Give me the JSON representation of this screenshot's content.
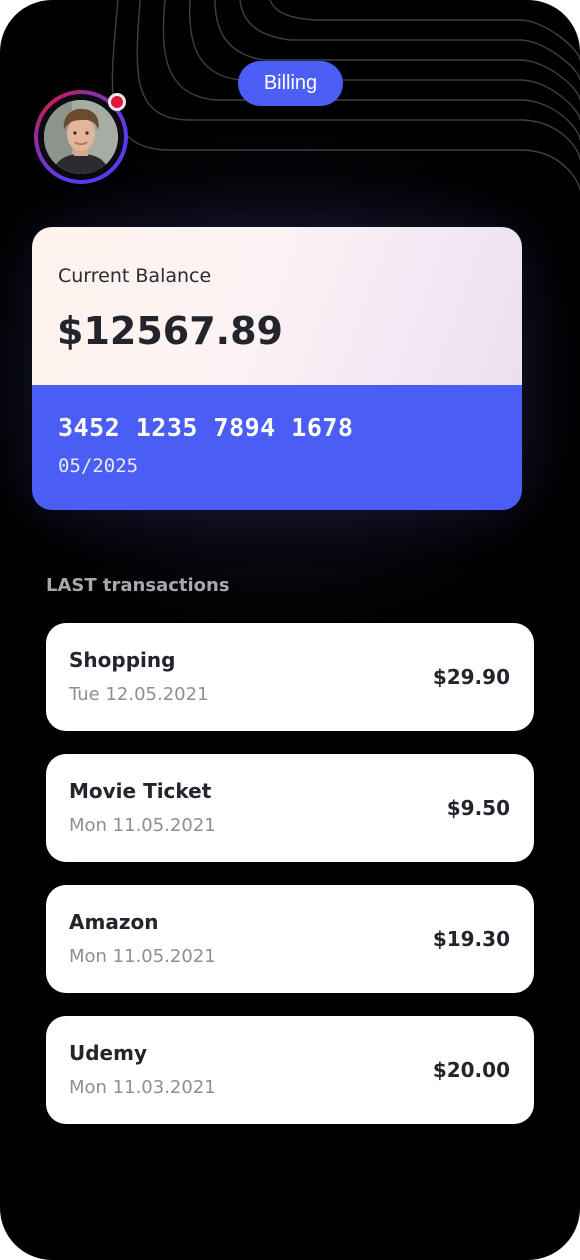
{
  "header": {
    "tab_label": "Billing",
    "colors": {
      "tab": "#4b5ef5",
      "notification": "#e3153c"
    }
  },
  "card": {
    "balance_label": "Current Balance",
    "balance_value": "$12567.89",
    "card_number": "3452 1235 7894 1678",
    "expiry": "05/2025",
    "colors": {
      "bottom": "#4a5ef5"
    }
  },
  "transactions": {
    "section_label": "LAST transactions",
    "items": [
      {
        "title": "Shopping",
        "date": "Tue 12.05.2021",
        "amount": "$29.90"
      },
      {
        "title": "Movie Ticket",
        "date": "Mon 11.05.2021",
        "amount": "$9.50"
      },
      {
        "title": "Amazon",
        "date": "Mon 11.05.2021",
        "amount": "$19.30"
      },
      {
        "title": "Udemy",
        "date": "Mon 11.03.2021",
        "amount": "$20.00"
      }
    ]
  }
}
